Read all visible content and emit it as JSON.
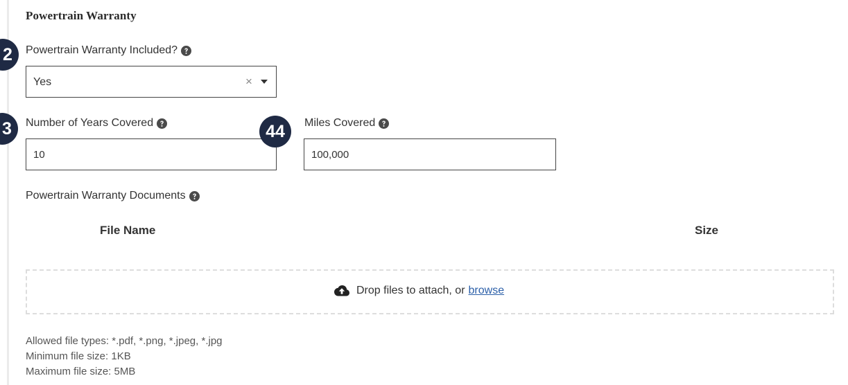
{
  "section": {
    "title": "Powertrain Warranty"
  },
  "warranty_included": {
    "label": "Powertrain Warranty Included?",
    "value": "Yes",
    "clear_glyph": "×"
  },
  "years": {
    "label": "Number of Years Covered",
    "value": "10"
  },
  "miles": {
    "label": "Miles Covered",
    "value": "100,000"
  },
  "documents": {
    "label": "Powertrain Warranty Documents",
    "columns": {
      "file_name": "File Name",
      "size": "Size"
    },
    "dropzone": {
      "text": "Drop files to attach, or",
      "link": "browse"
    },
    "rules": [
      "Allowed file types: *.pdf, *.png, *.jpeg, *.jpg",
      "Minimum file size: 1KB",
      "Maximum file size: 5MB"
    ]
  },
  "badges": {
    "b2": "2",
    "b3": "3",
    "b44": "44"
  },
  "icons": {
    "help": "question-circle-icon",
    "upload": "cloud-upload-icon",
    "dropdown": "chevron-down-icon",
    "clear": "close-icon"
  },
  "colors": {
    "badge_bg": "#1f2a44",
    "link": "#2b5fa8",
    "dropzone_border": "#dddddd"
  }
}
